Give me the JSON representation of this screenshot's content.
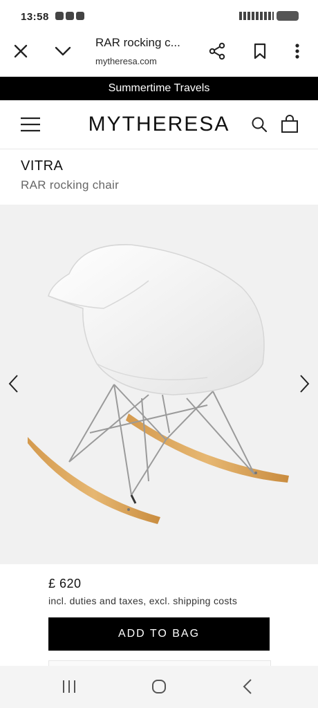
{
  "status_bar": {
    "time": "13:58"
  },
  "browser": {
    "page_title": "RAR rocking c...",
    "url": "mytheresa.com",
    "icons": [
      "close-icon",
      "chevron-down-icon",
      "share-icon",
      "bookmark-icon",
      "more-vert-icon"
    ]
  },
  "promo_banner": {
    "text": "Summertime Travels"
  },
  "site_header": {
    "logo": "MYTHERESA",
    "icons": [
      "hamburger-menu-icon",
      "search-icon",
      "shopping-bag-icon"
    ]
  },
  "product": {
    "brand": "VITRA",
    "name": "RAR rocking chair",
    "price": "£ 620",
    "price_note": "incl. duties and taxes, excl. shipping costs",
    "add_to_bag_label": "ADD TO BAG"
  },
  "gallery": {
    "icons": [
      "chevron-left-icon",
      "chevron-right-icon"
    ]
  },
  "system_nav": {
    "icons": [
      "recents-icon",
      "home-icon",
      "back-icon"
    ]
  },
  "colors": {
    "background": "#ffffff",
    "promo_bar": "#000000",
    "image_bg": "#f1f1f1",
    "button": "#000000",
    "wood": "#d9a65c"
  }
}
